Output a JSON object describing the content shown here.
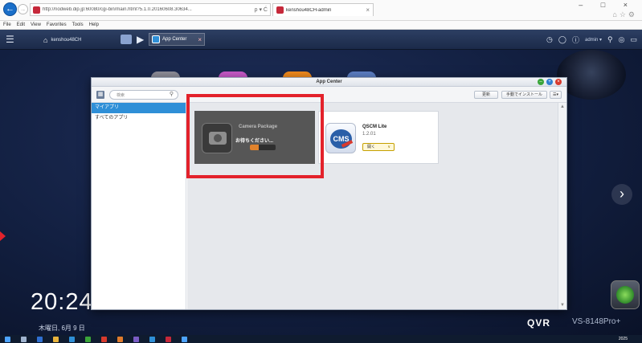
{
  "browser": {
    "url": "http://nodweb.dip.jp:60080/cgi-bin/main.html?5.1.0.20160608.30634...",
    "address_actions": "ρ ▾ Ć",
    "tab_title": "kenshou48CH-admin",
    "tab_close": "×",
    "window_controls": "– □ ×",
    "menu": [
      "File",
      "Edit",
      "View",
      "Favorites",
      "Tools",
      "Help"
    ]
  },
  "qts_bar": {
    "menu_icon": "hamburger-icon",
    "home_label": "kenshou48CH",
    "task_label": "App Center",
    "task_close": "×",
    "user_label": "admin ▾"
  },
  "app_center": {
    "title": "App Center",
    "search_placeholder": "検索",
    "refresh_label": "更新",
    "manual_install_label": "手動でインストール",
    "view_toggle_label": "☰▾",
    "sidebar_items": [
      {
        "label": "マイアプリ",
        "active": true
      },
      {
        "label": "すべてのアプリ",
        "active": false
      }
    ],
    "apps": [
      {
        "name": "Camera Package",
        "status": "お待ちください...",
        "progress": 0.35
      },
      {
        "name": "QSCM Lite",
        "version": "1.2.01",
        "button_label": "開く",
        "button_caret": "∨"
      }
    ]
  },
  "desktop": {
    "clock_time": "20:24",
    "clock_date": "木曜日, 6月 9 日",
    "brand": "QVR",
    "model": "VS-8148Pro+",
    "next_arrow": "›"
  },
  "taskbar": {
    "clock": "2025"
  },
  "colors": {
    "highlight": "#e3222b",
    "accent_blue": "#2f8fd7",
    "progress_orange": "#e0822c"
  }
}
